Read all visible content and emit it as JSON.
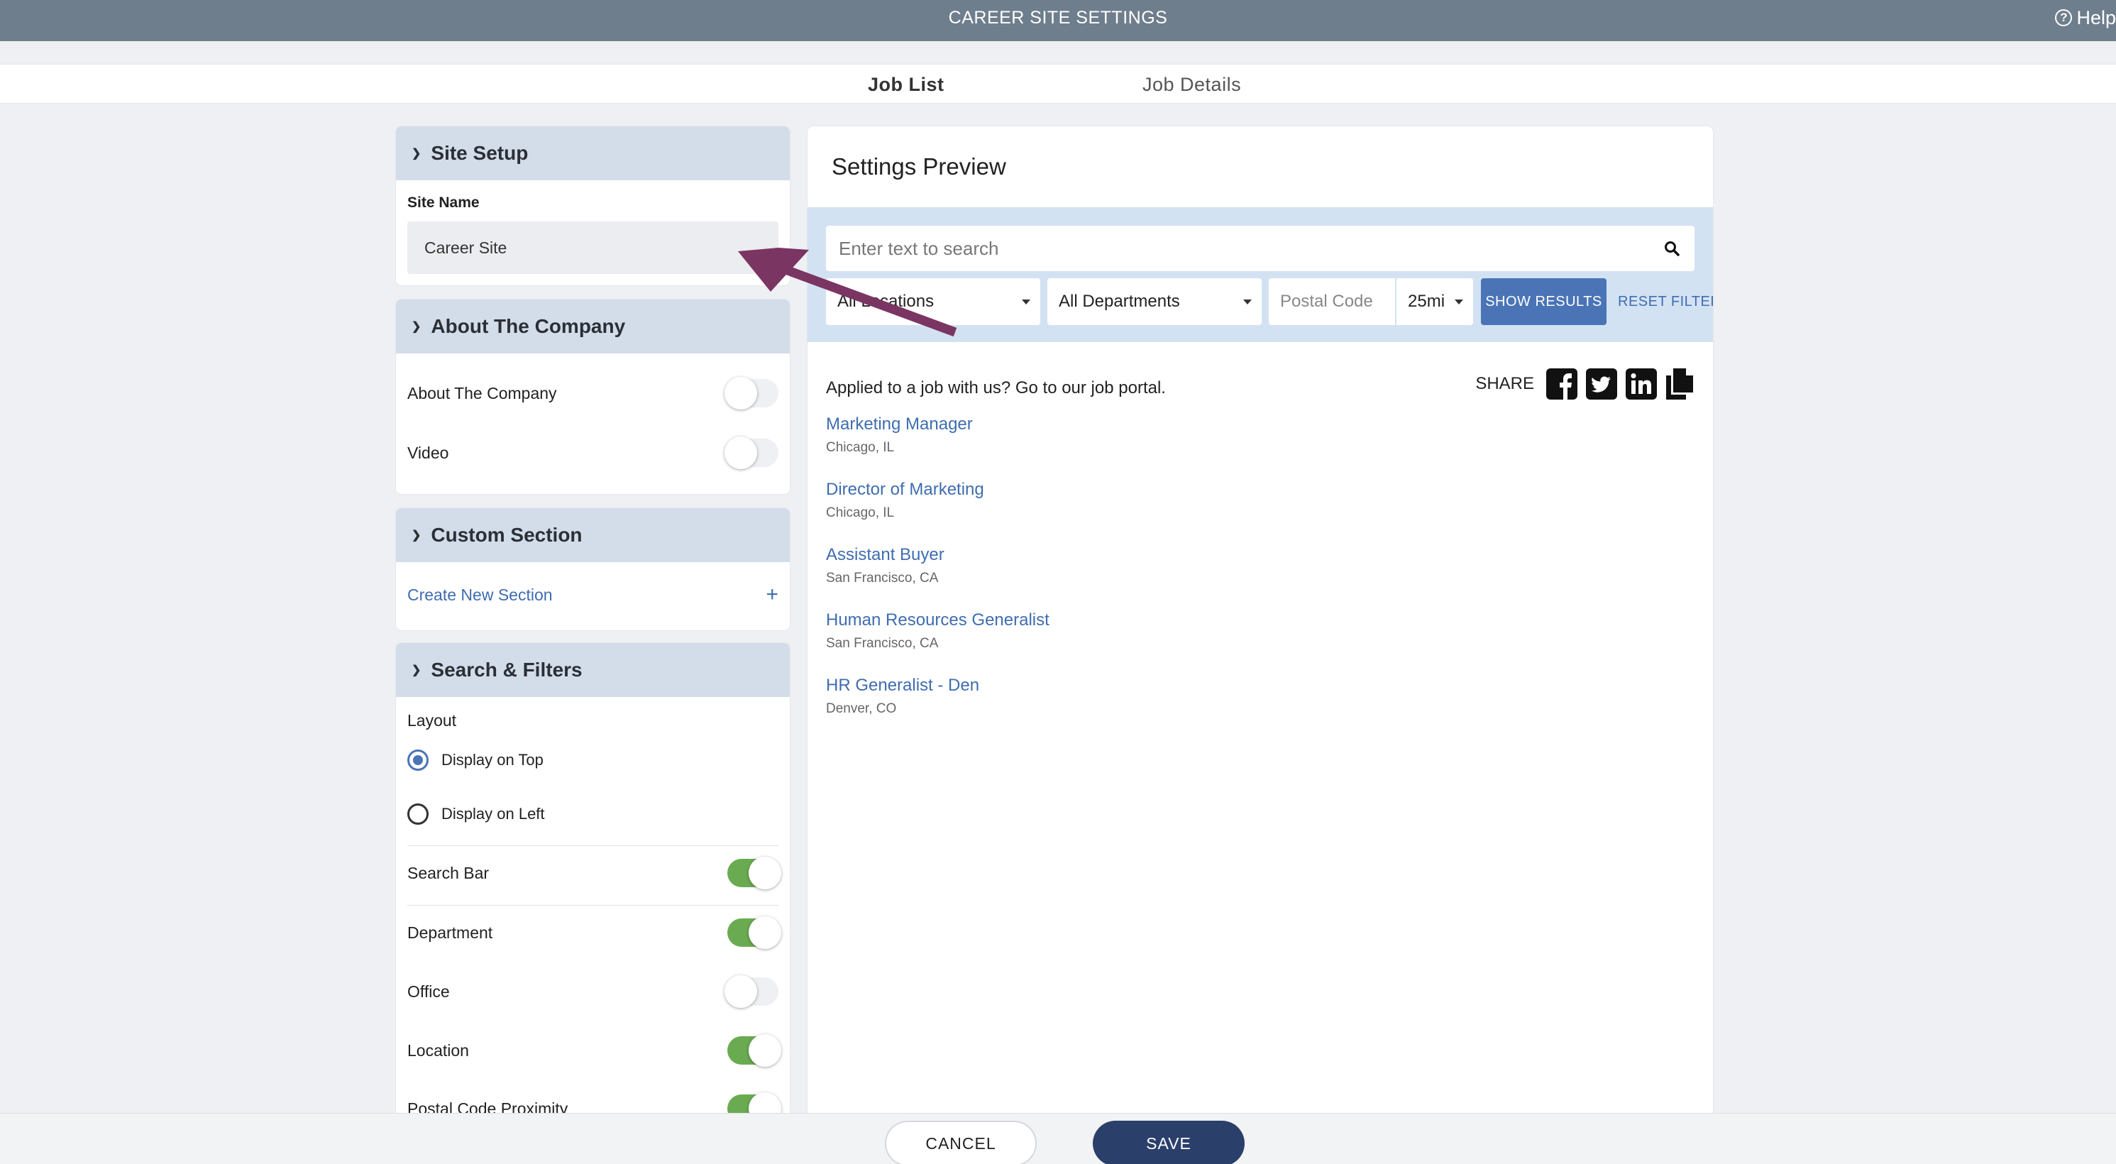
{
  "header": {
    "title": "CAREER SITE SETTINGS",
    "help_label": "Help",
    "help_glyph": "?"
  },
  "tabs": [
    {
      "label": "Job List",
      "active": true
    },
    {
      "label": "Job Details",
      "active": false
    }
  ],
  "site_setup": {
    "title": "Site Setup",
    "site_name_label": "Site Name",
    "site_name_value": "Career Site"
  },
  "about": {
    "title": "About The Company",
    "rows": [
      {
        "label": "About The Company",
        "on": false
      },
      {
        "label": "Video",
        "on": false
      }
    ]
  },
  "custom_section": {
    "title": "Custom Section",
    "create_label": "Create New Section",
    "plus": "+"
  },
  "search_filters": {
    "title": "Search & Filters",
    "layout_label": "Layout",
    "layout_options": [
      {
        "label": "Display on Top",
        "checked": true
      },
      {
        "label": "Display on Left",
        "checked": false
      }
    ],
    "toggles": [
      {
        "label": "Search Bar",
        "on": true
      },
      {
        "label": "Department",
        "on": true
      },
      {
        "label": "Office",
        "on": false
      },
      {
        "label": "Location",
        "on": true
      },
      {
        "label": "Postal Code Proximity",
        "on": true
      }
    ]
  },
  "preview": {
    "title": "Settings Preview",
    "search_placeholder": "Enter text to search",
    "locations": "All Locations",
    "departments": "All Departments",
    "postal_placeholder": "Postal Code",
    "radius": "25mi",
    "show_results": "SHOW RESULTS",
    "reset_filters": "RESET FILTERS",
    "portal_text": "Applied to a job with us? Go to our job portal.",
    "share_label": "SHARE",
    "share_icons": [
      "facebook-icon",
      "twitter-icon",
      "linkedin-icon",
      "copy-icon"
    ],
    "jobs": [
      {
        "title": "Marketing Manager",
        "location": "Chicago, IL"
      },
      {
        "title": "Director of Marketing",
        "location": "Chicago, IL"
      },
      {
        "title": "Assistant Buyer",
        "location": "San Francisco, CA"
      },
      {
        "title": "Human Resources Generalist",
        "location": "San Francisco, CA"
      },
      {
        "title": "HR Generalist - Den",
        "location": "Denver, CO"
      }
    ]
  },
  "footer": {
    "cancel_label": "CANCEL",
    "save_label": "SAVE"
  },
  "colors": {
    "header_bg": "#6f7e8c",
    "panel_head_bg": "#d3ddea",
    "accent_blue": "#4a74b6",
    "link_blue": "#3f6db0",
    "toggle_on": "#6aab52",
    "save_bg": "#2b3f6b",
    "annotation_arrow": "#7b3563"
  }
}
